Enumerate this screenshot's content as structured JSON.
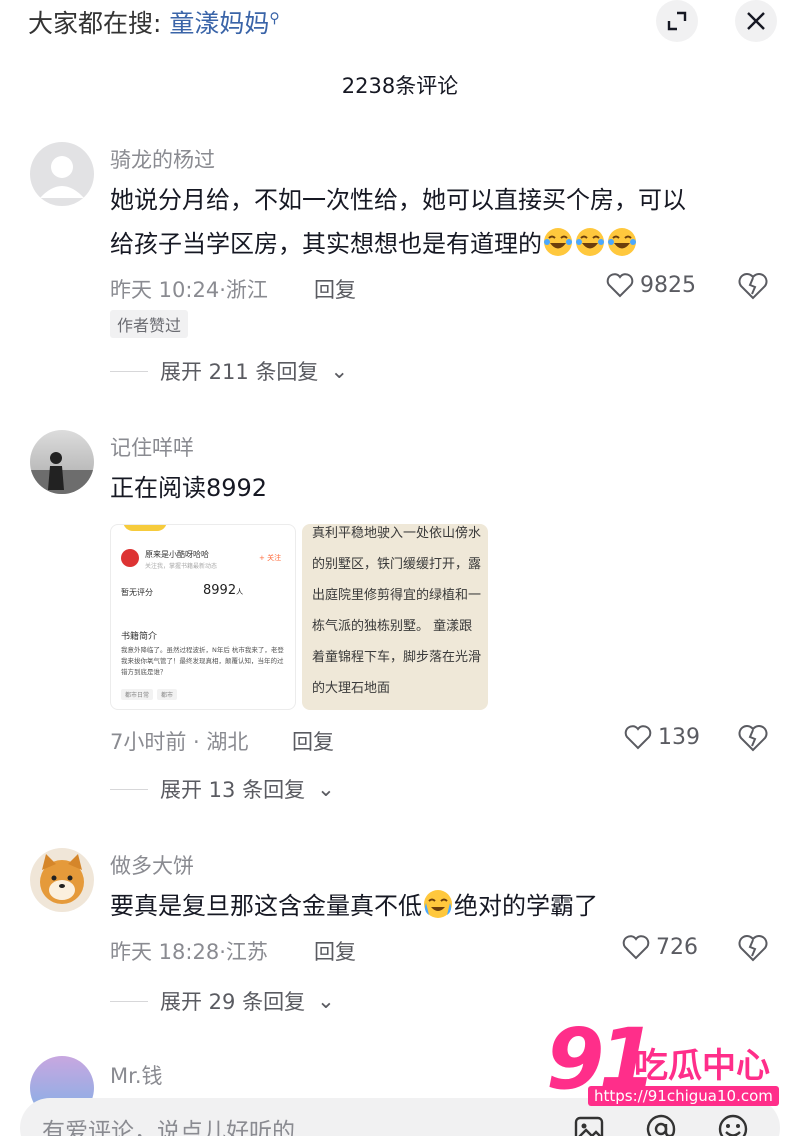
{
  "header": {
    "search_prefix": "大家都在搜:",
    "search_term": "童漾妈妈",
    "expand_icon": "expand-icon",
    "close_icon": "close-icon"
  },
  "comment_count": "2238条评论",
  "comments": [
    {
      "username": "骑龙的杨过",
      "text_line1": "她说分月给，不如一次性给，她可以直接买个房，可以",
      "text_line2": "给孩子当学区房，其实想想也是有道理的",
      "time": "昨天 10:24",
      "location": "浙江",
      "reply_label": "回复",
      "likes": "9825",
      "badge": "作者赞过",
      "expand_label": "展开 211 条回复"
    },
    {
      "username": "记住咩咩",
      "text": "正在阅读8992",
      "time": "7小时前",
      "location": "湖北",
      "reply_label": "回复",
      "likes": "139",
      "expand_label": "展开 13 条回复",
      "thumb1": {
        "title": "原来是小酷呀哈哈",
        "subtitle": "关注我，掌握书籍最新动态",
        "follow": "+ 关注",
        "rating_label": "暂无评分",
        "reader_count": "8992",
        "reader_unit": "人",
        "section": "书籍简介",
        "body": "我意外降临了。虽然过程波折，N年后 杭市我来了，老登 我来拔你氧气管了！最终发现真相，颠覆认知，当年的过错方到底是谁？",
        "tag1": "都市日常",
        "tag2": "都市"
      },
      "thumb2": {
        "text": "真利平稳地驶入一处依山傍水的别墅区，铁门缓缓打开，露出庭院里修剪得宜的绿植和一栋气派的独栋别墅。 童漾跟着童锦程下车，脚步落在光滑的大理石地面"
      }
    },
    {
      "username": "做多大饼",
      "text_before": "要真是复旦那这含金量真不低",
      "text_after": "绝对的学霸了",
      "time": "昨天 18:28",
      "location": "江苏",
      "reply_label": "回复",
      "likes": "726",
      "expand_label": "展开 29 条回复"
    },
    {
      "username": "Mr.钱"
    }
  ],
  "comment_input": {
    "placeholder": "有爱评论，说点儿好听的"
  },
  "watermark": {
    "number": "91",
    "name": "吃瓜中心",
    "url": "https://91chigua10.com"
  },
  "colors": {
    "link": "#3a64a8",
    "muted": "#8a8b91",
    "watermark": "#ff2e8a"
  }
}
